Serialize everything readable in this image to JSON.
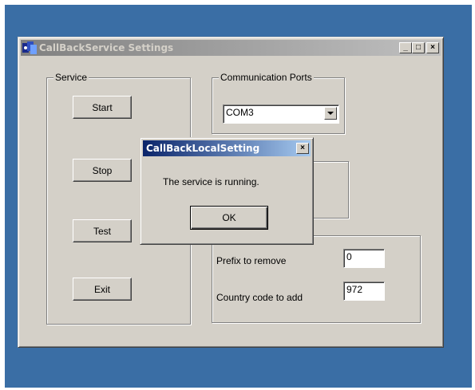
{
  "main_window": {
    "title": "CallBackService Settings",
    "controls": {
      "minimize": "_",
      "maximize": "□",
      "close": "×"
    },
    "service_group": {
      "label": "Service",
      "buttons": {
        "start": "Start",
        "stop": "Stop",
        "test": "Test",
        "exit": "Exit"
      }
    },
    "ports_group": {
      "label": "Communication Ports",
      "selected_port": "COM3"
    },
    "settings_group": {
      "prefix_label": "Prefix to remove",
      "prefix_value": "0",
      "country_label": "Country code to add",
      "country_value": "972"
    }
  },
  "dialog": {
    "title": "CallBackLocalSetting",
    "close": "×",
    "message": "The service is running.",
    "ok_label": "OK"
  },
  "colors": {
    "desktop": "#3a6ea5",
    "window_face": "#d4d0c8",
    "active_title": "#0a246a",
    "inactive_title": "#808080"
  }
}
